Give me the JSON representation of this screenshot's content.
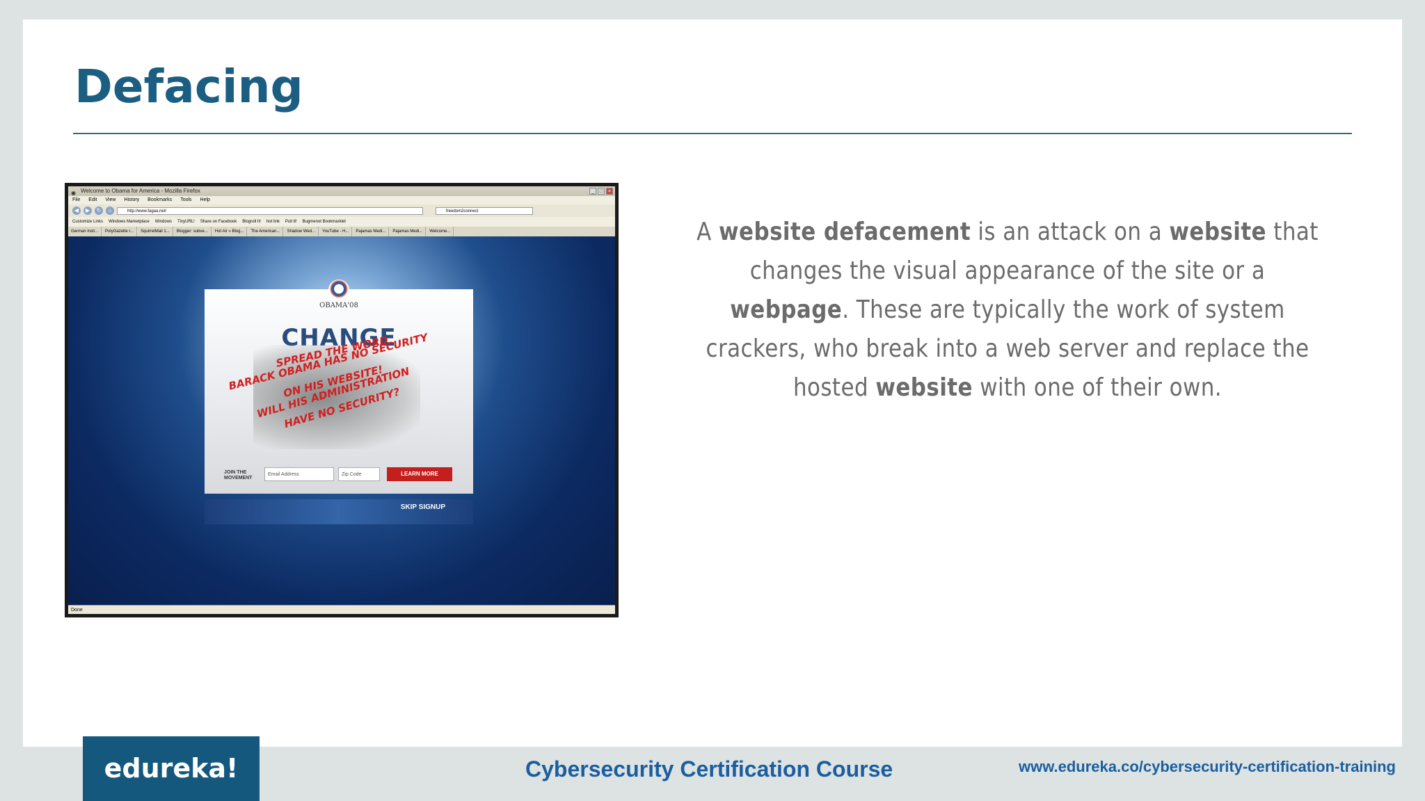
{
  "slide": {
    "title": "Defacing",
    "body": [
      {
        "t": "A ",
        "b": false
      },
      {
        "t": "website defacement",
        "b": true
      },
      {
        "t": " is an attack on a ",
        "b": false
      },
      {
        "t": "website",
        "b": true
      },
      {
        "t": " that changes the visual appearance of the site or a ",
        "b": false
      },
      {
        "t": "webpage",
        "b": true
      },
      {
        "t": ". These are typically the work of system crackers, who break into a web server and replace the hosted ",
        "b": false
      },
      {
        "t": "website",
        "b": true
      },
      {
        "t": " with one of their own.",
        "b": false
      }
    ]
  },
  "screenshot": {
    "window_title": "Welcome to Obama for America - Mozilla Firefox",
    "menu": [
      "File",
      "Edit",
      "View",
      "History",
      "Bookmarks",
      "Tools",
      "Help"
    ],
    "url": "http://www.fagaa.net/",
    "search_value": "freedom2connect",
    "bookmarks": [
      "Customize Links",
      "Windows Marketplace",
      "Windows",
      "TinyURL!",
      "Share on Facebook",
      "Blogroll It!",
      "hot link",
      "Pull It!",
      "Bugmenot Bookmarklet"
    ],
    "tabs": [
      "German insti...",
      "PolyGazette r...",
      "SquirrelMail 1...",
      "Blogger: subve...",
      "Hot Air » Blog...",
      "The American...",
      "Shadow Wed...",
      "YouTube - H...",
      "Pajamas Medi...",
      "Pajamas Medi...",
      "Welcome..."
    ],
    "status": "Done",
    "page": {
      "logo_text": "OBAMA'08",
      "headline": "CHANGE",
      "graffiti": [
        "SPREAD THE WORD",
        "BARACK OBAMA HAS NO SECURITY",
        "ON HIS WEBSITE!",
        "WILL HIS ADMINISTRATION",
        "HAVE NO SECURITY?"
      ],
      "join_label": "JOIN THE MOVEMENT",
      "email_placeholder": "Email Address",
      "zip_placeholder": "Zip Code",
      "learn_button": "LEARN MORE",
      "skip_label": "SKIP SIGNUP"
    }
  },
  "footer": {
    "brand": "edureka!",
    "course": "Cybersecurity Certification Course",
    "url": "www.edureka.co/cybersecurity-certification-training"
  },
  "colors": {
    "title": "#1b5e82",
    "brand_box": "#14587e",
    "footer_text": "#1b5ea0",
    "body_text": "#6b6b6b",
    "graffiti": "#d21f1f"
  }
}
